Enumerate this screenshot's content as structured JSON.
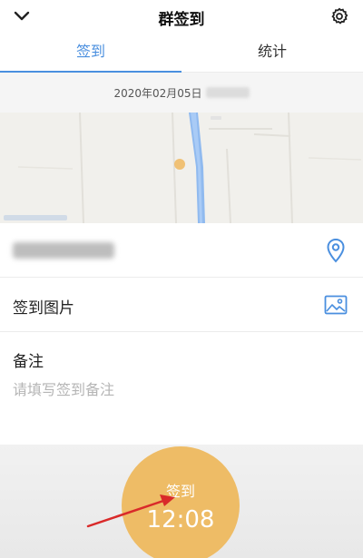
{
  "header": {
    "title": "群签到",
    "back_icon": "chevron-down-icon",
    "settings_icon": "gear-icon"
  },
  "tabs": [
    {
      "label": "签到",
      "active": true
    },
    {
      "label": "统计",
      "active": false
    }
  ],
  "date_row": {
    "date": "2020年02月05日"
  },
  "location": {
    "icon": "location-pin-icon"
  },
  "photo": {
    "label": "签到图片",
    "icon": "image-icon"
  },
  "note": {
    "label": "备注",
    "placeholder": "请填写签到备注"
  },
  "checkin_button": {
    "label": "签到",
    "time": "12:08"
  },
  "colors": {
    "accent": "#4a8fdf",
    "button": "#eebc66",
    "arrow": "#d92a2a"
  }
}
